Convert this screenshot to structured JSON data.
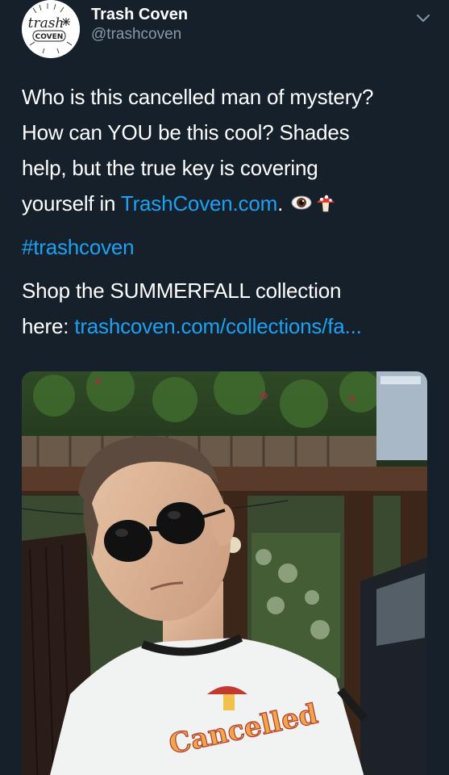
{
  "header": {
    "display_name": "Trash Coven",
    "handle": "@trashcoven",
    "avatar_text_top": "trash",
    "avatar_text_bottom": "COVEN"
  },
  "tweet": {
    "line1": "Who is this cancelled man of mystery?",
    "line2": "How can YOU be this cool? Shades",
    "line3": "help, but the true key is covering",
    "line4_prefix": "yourself in ",
    "line4_link": "TrashCoven.com",
    "line4_suffix": ". ",
    "hashtag": "#trashcoven",
    "shop_line1": "Shop the SUMMERFALL collection",
    "shop_line2_prefix": "here: ",
    "shop_link": "trashcoven.com/collections/fa..."
  },
  "media": {
    "shirt_text": "Cancelled"
  },
  "colors": {
    "background": "#15202b",
    "text": "#ffffff",
    "secondary_text": "#8899a6",
    "link": "#1da1f2"
  },
  "icons": {
    "more": "chevron-down-icon",
    "emoji1": "eye-emoji",
    "emoji2": "mushroom-emoji"
  }
}
